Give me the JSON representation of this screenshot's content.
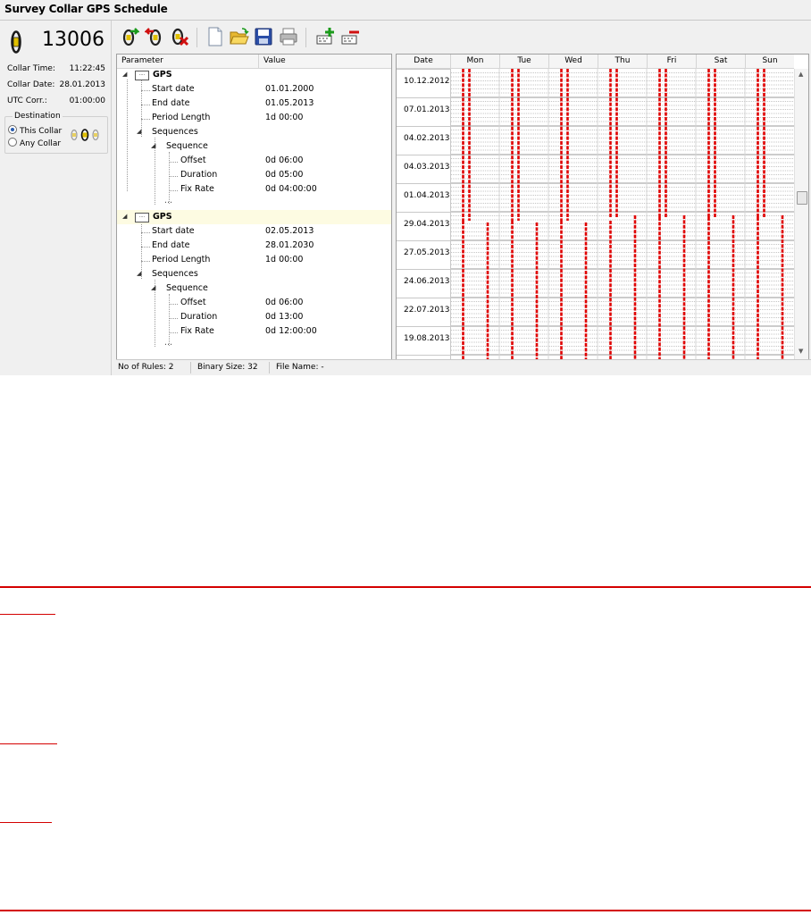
{
  "window": {
    "title": "Survey Collar GPS Schedule"
  },
  "collar": {
    "id": "13006",
    "time_label": "Collar Time:",
    "time_value": "11:22:45",
    "date_label": "Collar Date:",
    "date_value": "28.01.2013",
    "utc_label": "UTC Corr.:",
    "utc_value": "01:00:00"
  },
  "destination": {
    "title": "Destination",
    "options": [
      {
        "label": "This Collar",
        "selected": true
      },
      {
        "label": "Any Collar",
        "selected": false
      }
    ]
  },
  "toolbar": {
    "icons": [
      "read-from-collar-icon",
      "write-to-collar-icon",
      "delete-from-collar-icon",
      "new-file-icon",
      "open-file-icon",
      "save-file-icon",
      "print-icon",
      "add-rule-icon",
      "remove-rule-icon"
    ]
  },
  "tree": {
    "col_parameter": "Parameter",
    "col_value": "Value",
    "rules": [
      {
        "type": "GPS",
        "start_label": "Start date",
        "start_value": "01.01.2000",
        "end_label": "End date",
        "end_value": "01.05.2013",
        "period_label": "Period Length",
        "period_value": "1d 00:00",
        "sequences_label": "Sequences",
        "sequence_label": "Sequence",
        "offset_label": "Offset",
        "offset_value": "0d 06:00",
        "duration_label": "Duration",
        "duration_value": "0d 05:00",
        "fixrate_label": "Fix Rate",
        "fixrate_value": "0d 04:00:00",
        "more": "..."
      },
      {
        "type": "GPS",
        "start_label": "Start date",
        "start_value": "02.05.2013",
        "end_label": "End date",
        "end_value": "28.01.2030",
        "period_label": "Period Length",
        "period_value": "1d 00:00",
        "sequences_label": "Sequences",
        "sequence_label": "Sequence",
        "offset_label": "Offset",
        "offset_value": "0d 06:00",
        "duration_label": "Duration",
        "duration_value": "0d 13:00",
        "fixrate_label": "Fix Rate",
        "fixrate_value": "0d 12:00:00",
        "more": "..."
      }
    ]
  },
  "calendar": {
    "date_header": "Date",
    "days": [
      "Mon",
      "Tue",
      "Wed",
      "Thu",
      "Fri",
      "Sat",
      "Sun"
    ],
    "dates": [
      "10.12.2012",
      "07.01.2013",
      "04.02.2013",
      "04.03.2013",
      "01.04.2013",
      "29.04.2013",
      "27.05.2013",
      "24.06.2013",
      "22.07.2013",
      "19.08.2013"
    ],
    "mark_color": "#e00000"
  },
  "status": {
    "rules": "No of Rules: 2",
    "binary": "Binary Size: 32",
    "file": "File Name: -"
  },
  "colors": {
    "accent_red": "#d40000",
    "selection": "#fdfbe2"
  }
}
